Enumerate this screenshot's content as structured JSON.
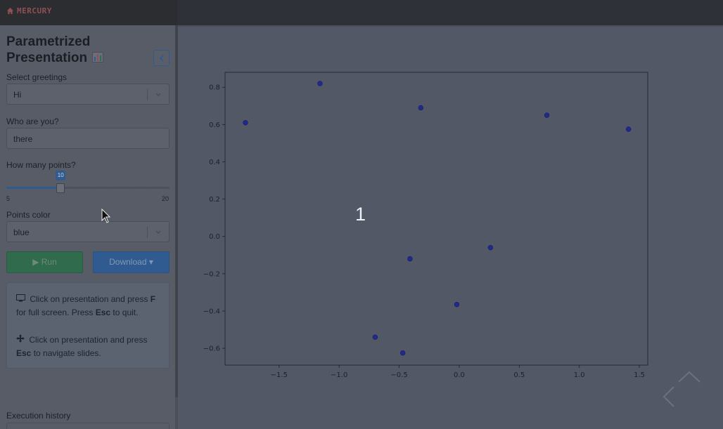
{
  "app": {
    "brand": "MERCURY"
  },
  "sidebar": {
    "title": "Parametrized Presentation",
    "title_icon": "bar-chart-emoji-icon",
    "collapse_icon": "chevron-left-icon",
    "greetings": {
      "label": "Select greetings",
      "value": "Hi"
    },
    "who": {
      "label": "Who are you?",
      "value": "there"
    },
    "points": {
      "label": "How many points?",
      "value": "10",
      "min": "5",
      "max": "20",
      "fraction": 0.333
    },
    "color": {
      "label": "Points color",
      "value": "blue"
    },
    "run_label": "▶ Run",
    "download_label": "Download ▾",
    "info": {
      "line1_pre": "Click on presentation and press",
      "line1_key": "F",
      "line1_post": "for full screen. Press",
      "line1_key2": "Esc",
      "line1_end": "to quit.",
      "line2_pre": "Click on presentation and press",
      "line2_key": "Esc",
      "line2_post": "to navigate slides."
    },
    "history_label": "Execution history"
  },
  "slide": {
    "number": "1"
  },
  "colors": {
    "accent": "#2f5b90",
    "run": "#2f6b4c",
    "points": "#1f2a8c"
  },
  "chart_data": {
    "type": "scatter",
    "x": [
      -1.78,
      -1.16,
      -0.32,
      0.73,
      1.41,
      -0.41,
      0.26,
      -0.02,
      -0.7,
      -0.47
    ],
    "y": [
      0.61,
      0.82,
      0.69,
      0.65,
      0.575,
      -0.12,
      -0.06,
      -0.365,
      -0.54,
      -0.625
    ],
    "xlim": [
      -1.95,
      1.57
    ],
    "ylim": [
      -0.69,
      0.88
    ],
    "xticks": [
      "−1.5",
      "−1.0",
      "−0.5",
      "0.0",
      "0.5",
      "1.0",
      "1.5"
    ],
    "xtick_values": [
      -1.5,
      -1.0,
      -0.5,
      0.0,
      0.5,
      1.0,
      1.5
    ],
    "yticks": [
      "0.8",
      "0.6",
      "0.4",
      "0.2",
      "0.0",
      "−0.2",
      "−0.4",
      "−0.6"
    ],
    "ytick_values": [
      0.8,
      0.6,
      0.4,
      0.2,
      0.0,
      -0.2,
      -0.4,
      -0.6
    ],
    "color": "blue",
    "title": "",
    "xlabel": "",
    "ylabel": "",
    "grid": false
  }
}
